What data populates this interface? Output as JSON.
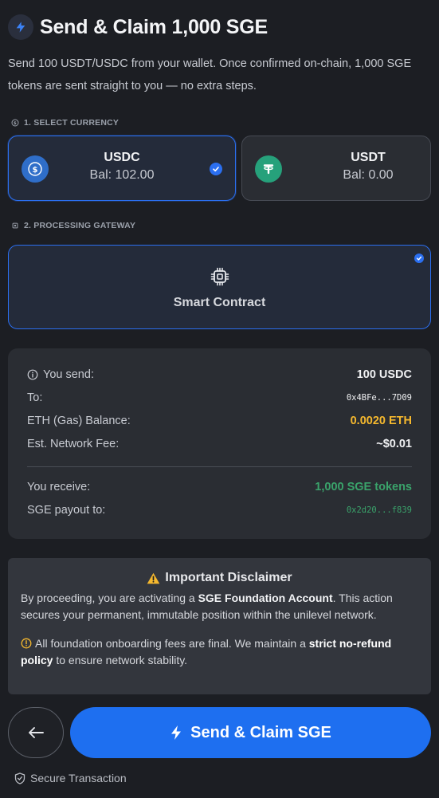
{
  "header": {
    "title": "Send & Claim 1,000 SGE",
    "icon": "bolt-icon"
  },
  "description": "Send 100 USDT/USDC from your wallet. Once confirmed on-chain, 1,000 SGE tokens are sent straight to you — no extra steps.",
  "section1": {
    "label": "1. SELECT CURRENCY"
  },
  "currencies": [
    {
      "name": "USDC",
      "balance": "Bal: 102.00",
      "selected": true,
      "color": "#2f6ec9"
    },
    {
      "name": "USDT",
      "balance": "Bal: 0.00",
      "selected": false,
      "color": "#26a17b"
    }
  ],
  "section2": {
    "label": "2. PROCESSING GATEWAY"
  },
  "gateway": {
    "label": "Smart Contract",
    "selected": true
  },
  "summary": {
    "send_label": "You send:",
    "send_value": "100 USDC",
    "to_label": "To:",
    "to_value": "0x4BFe...7D09",
    "gas_label": "ETH (Gas) Balance:",
    "gas_value": "0.0020 ETH",
    "fee_label": "Est. Network Fee:",
    "fee_value": "~$0.01",
    "receive_label": "You receive:",
    "receive_value": "1,000 SGE tokens",
    "payout_label": "SGE payout to:",
    "payout_value": "0x2d20...f839"
  },
  "disclaimer": {
    "title": "Important Disclaimer",
    "body_pre": "By proceeding, you are activating a ",
    "body_bold": "SGE Foundation Account",
    "body_post": ". This action secures your permanent, immutable position within the unilevel network.",
    "note_pre": "All foundation onboarding fees are final. We maintain a ",
    "note_bold": "strict no-refund policy",
    "note_post": " to ensure network stability."
  },
  "actions": {
    "send_label": "Send & Claim SGE"
  },
  "footer": {
    "secure_label": "Secure Transaction"
  },
  "colors": {
    "accent": "#1e6ff0",
    "gas": "#f5b82e",
    "receive": "#3aa36b",
    "warning": "#f5b82e"
  }
}
